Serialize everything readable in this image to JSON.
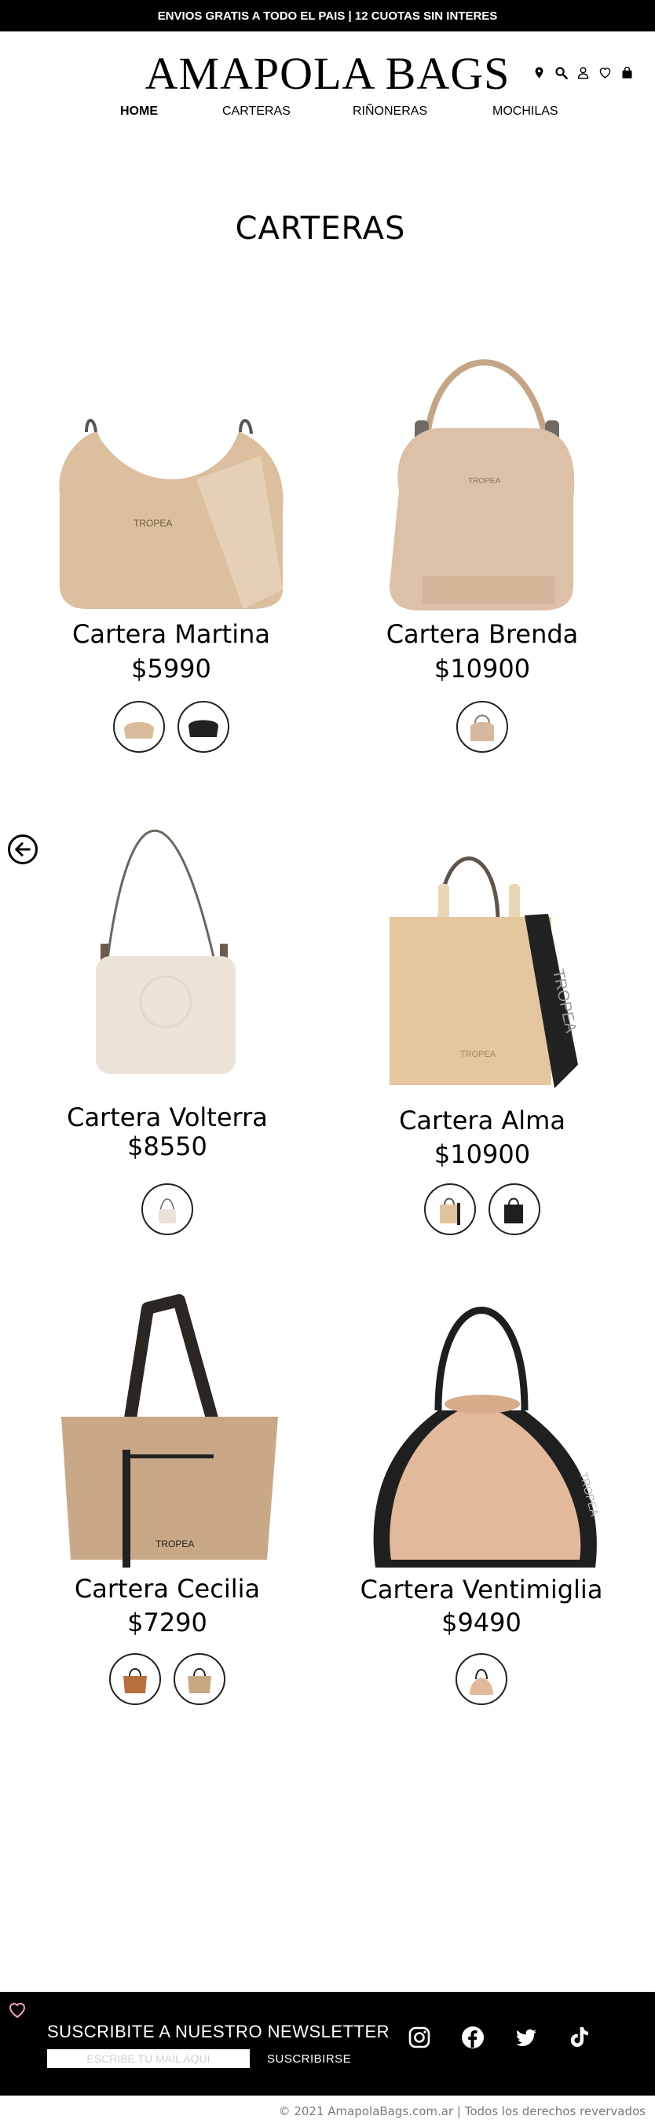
{
  "topbar": {
    "text": "ENVIOS GRATIS A TODO EL PAIS | 12 CUOTAS SIN INTERES"
  },
  "header": {
    "logo": "AMAPOLA BAGS",
    "icons": [
      "location-icon",
      "search-icon",
      "user-icon",
      "heart-icon",
      "bag-icon"
    ]
  },
  "nav": {
    "items": [
      {
        "label": "HOME",
        "active": true
      },
      {
        "label": "CARTERAS",
        "active": false
      },
      {
        "label": "RIÑONERAS",
        "active": false
      },
      {
        "label": "MOCHILAS",
        "active": false
      }
    ]
  },
  "page": {
    "title": "CARTERAS"
  },
  "back_button": {
    "icon": "arrow-left-circle-icon"
  },
  "products": [
    {
      "name": "Cartera Martina",
      "price": "$5990",
      "colors": [
        "#d9bc9c",
        "#222222"
      ]
    },
    {
      "name": "Cartera Brenda",
      "price": "$10900",
      "colors": [
        "#d7b89e"
      ]
    },
    {
      "name": "Cartera Volterra",
      "price": "$8550",
      "colors": [
        "#ece3d8"
      ]
    },
    {
      "name": "Cartera Alma",
      "price": "$10900",
      "colors": [
        "#dfc39c",
        "#1f1f1f"
      ]
    },
    {
      "name": "Cartera Cecilia",
      "price": "$7290",
      "colors": [
        "#b86f3d",
        "#c8a882"
      ]
    },
    {
      "name": "Cartera Ventimiglia",
      "price": "$9490",
      "colors": [
        "#e2b99b"
      ]
    }
  ],
  "footer": {
    "newsletter_title": "SUSCRIBITE A NUESTRO NEWSLETTER",
    "email_placeholder": "ESCRIBE TU MAIL AQUI",
    "subscribe_label": "SUSCRIBIRSE",
    "social": [
      "instagram-icon",
      "facebook-icon",
      "twitter-icon",
      "tiktok-icon"
    ],
    "copyright": "© 2021 AmapolaBags.com.ar | Todos los derechos revervados"
  },
  "colors": {
    "black": "#000000",
    "beige": "#dcc3a3",
    "footer_text": "#ffffff"
  }
}
